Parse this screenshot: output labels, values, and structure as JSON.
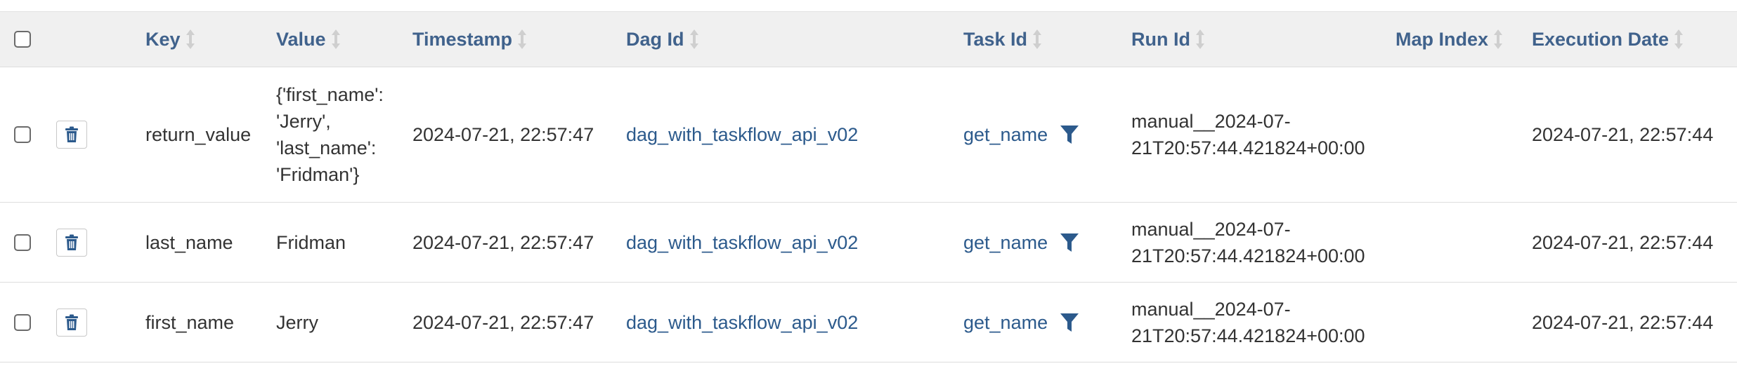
{
  "columns": {
    "key": "Key",
    "value": "Value",
    "timestamp": "Timestamp",
    "dag_id": "Dag Id",
    "task_id": "Task Id",
    "run_id": "Run Id",
    "map_index": "Map Index",
    "execution_date": "Execution Date"
  },
  "icons": {
    "delete": "trash-icon",
    "filter": "filter-icon",
    "sort": "sort-icon"
  },
  "colors": {
    "link": "#2c5a8c",
    "header_text": "#40628c",
    "header_bg": "#f0f0f0"
  },
  "rows": [
    {
      "key": "return_value",
      "value": "{'first_name': 'Jerry', 'last_name': 'Fridman'}",
      "timestamp": "2024-07-21, 22:57:47",
      "dag_id": "dag_with_taskflow_api_v02",
      "task_id": "get_name",
      "run_id": "manual__2024-07-21T20:57:44.421824+00:00",
      "map_index": "",
      "execution_date": "2024-07-21, 22:57:44"
    },
    {
      "key": "last_name",
      "value": "Fridman",
      "timestamp": "2024-07-21, 22:57:47",
      "dag_id": "dag_with_taskflow_api_v02",
      "task_id": "get_name",
      "run_id": "manual__2024-07-21T20:57:44.421824+00:00",
      "map_index": "",
      "execution_date": "2024-07-21, 22:57:44"
    },
    {
      "key": "first_name",
      "value": "Jerry",
      "timestamp": "2024-07-21, 22:57:47",
      "dag_id": "dag_with_taskflow_api_v02",
      "task_id": "get_name",
      "run_id": "manual__2024-07-21T20:57:44.421824+00:00",
      "map_index": "",
      "execution_date": "2024-07-21, 22:57:44"
    }
  ]
}
